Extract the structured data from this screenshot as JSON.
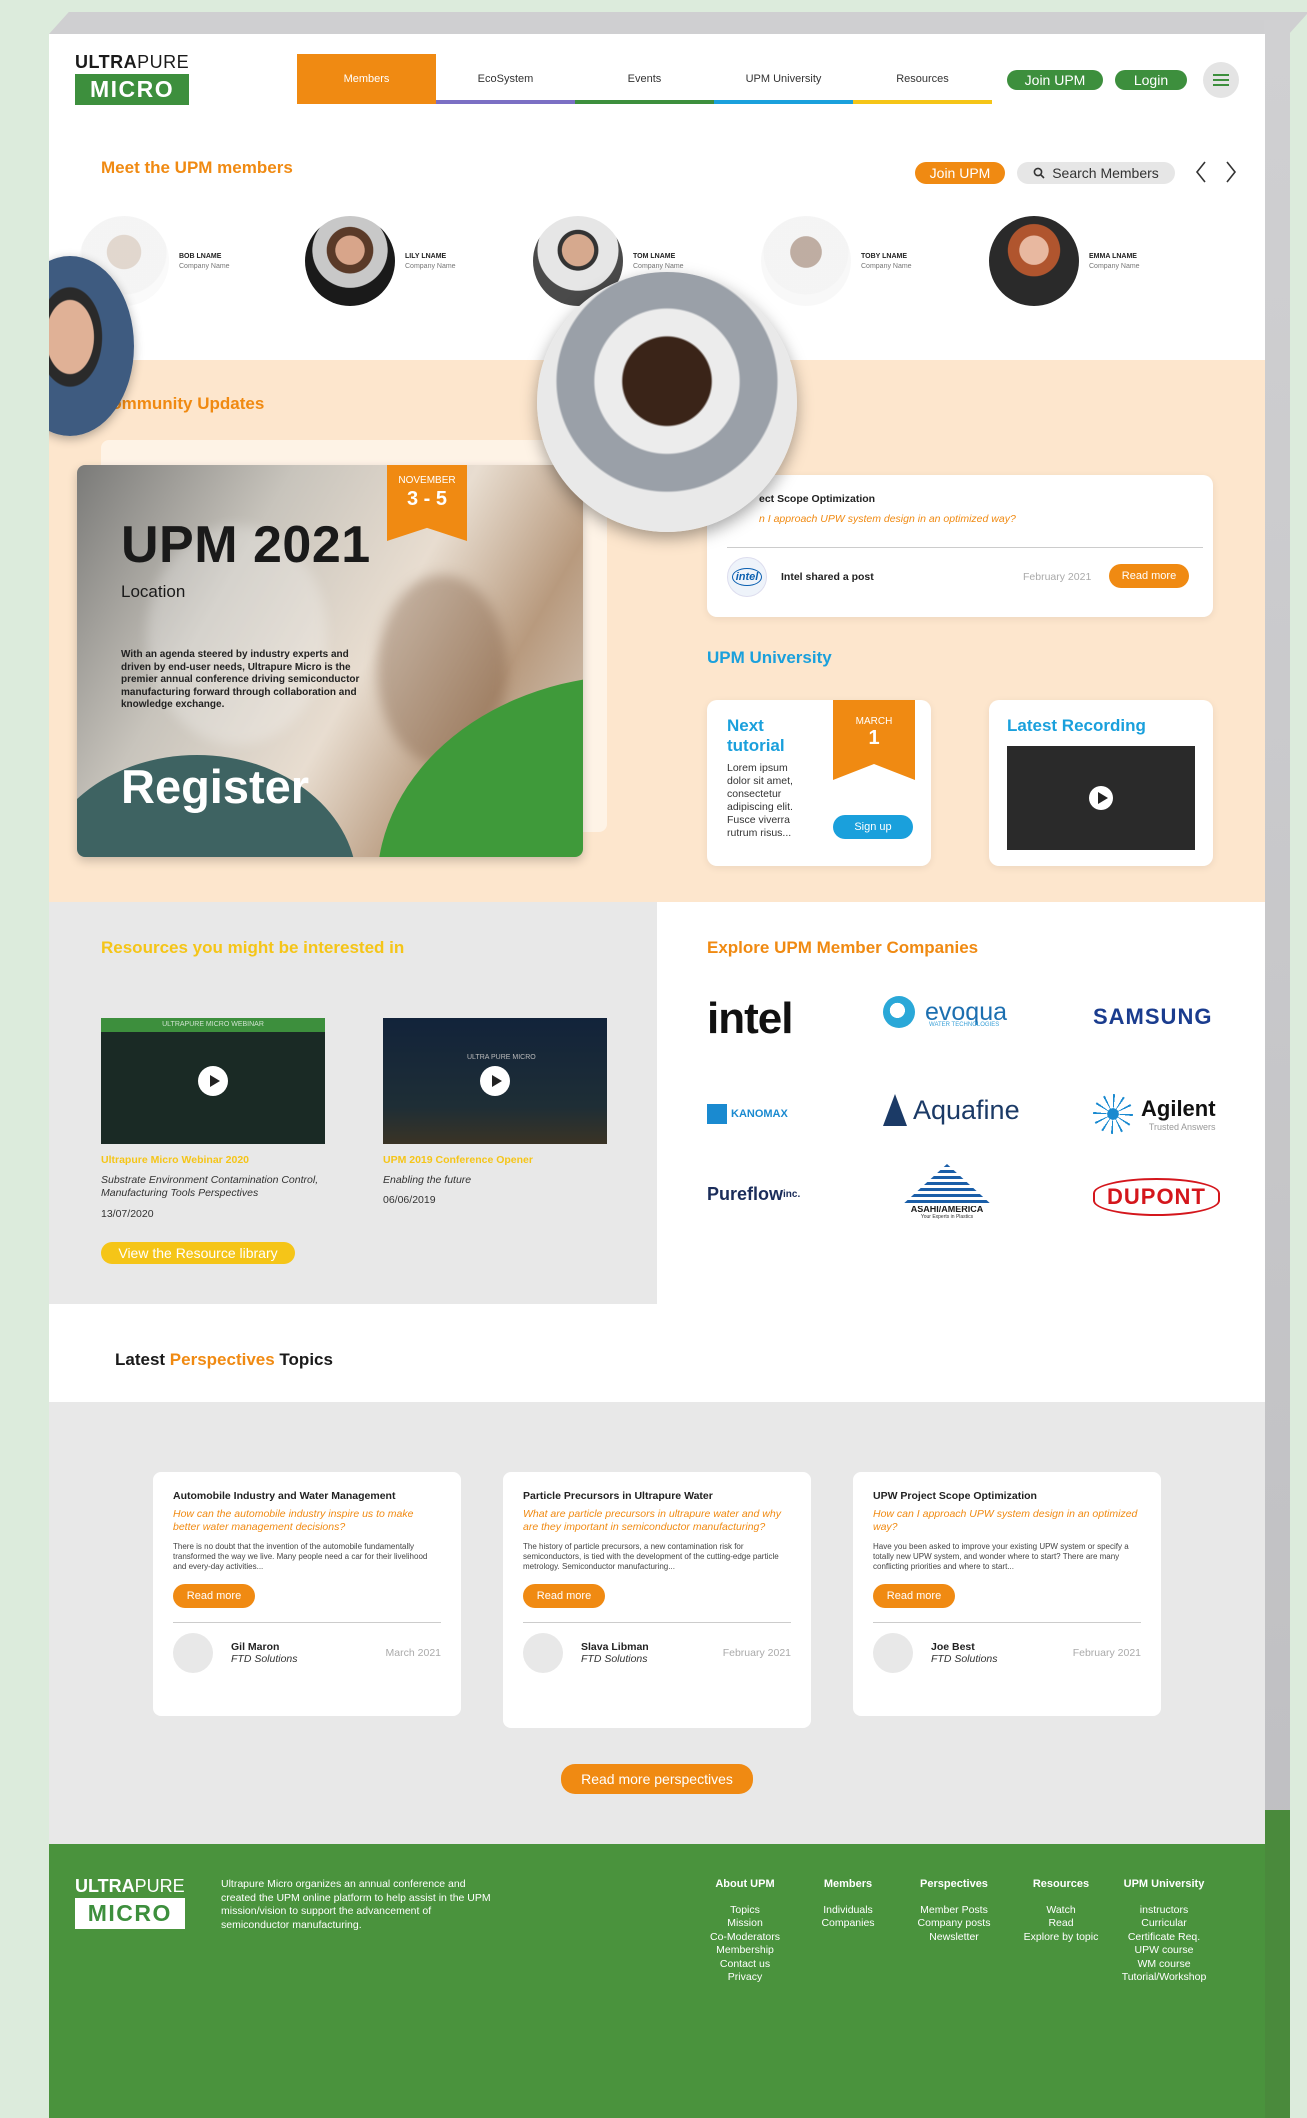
{
  "brand": {
    "top_bold": "ULTRA",
    "top_light": "PURE",
    "bottom": "MICRO"
  },
  "nav": {
    "items": [
      {
        "label": "Members",
        "color": "#f08a12"
      },
      {
        "label": "EcoSystem",
        "color": "#7b6fc4"
      },
      {
        "label": "Events",
        "color": "#3d8f3d"
      },
      {
        "label": "UPM University",
        "color": "#1aa0dc"
      },
      {
        "label": "Resources",
        "color": "#f5c518"
      }
    ],
    "join": "Join UPM",
    "login": "Login"
  },
  "members": {
    "title": "Meet the UPM members",
    "join": "Join UPM",
    "search": "Search Members",
    "list": [
      {
        "name": "BOB LNAME",
        "company": "Company Name"
      },
      {
        "name": "LILY LNAME",
        "company": "Company Name"
      },
      {
        "name": "TOM LNAME",
        "company": "Company Name"
      },
      {
        "name": "TOBY LNAME",
        "company": "Company Name"
      },
      {
        "name": "EMMA LNAME",
        "company": "Company Name"
      }
    ]
  },
  "community": {
    "title": "Community Updates",
    "event": {
      "month": "NOVEMBER",
      "days": "3 - 5",
      "title": "UPM 2021",
      "location": "Location",
      "desc": "With an agenda steered by industry experts and driven by end-user needs, Ultrapure Micro is the premier annual conference driving semiconductor manufacturing forward through collaboration and knowledge exchange.",
      "cta": "Register"
    },
    "post": {
      "title": "ect Scope Optimization",
      "question": "n I approach UPW system design in an optimized way?",
      "author_logo": "intel",
      "author": "Intel shared a post",
      "date": "February 2021",
      "read": "Read more"
    }
  },
  "university": {
    "title": "UPM University",
    "next": {
      "title": "Next tutorial",
      "text": "Lorem ipsum dolor sit amet, consectetur adipiscing elit. Fusce viverra rutrum risus...",
      "month": "MARCH",
      "day": "1",
      "cta": "Sign up"
    },
    "latest": {
      "title": "Latest Recording"
    }
  },
  "resources": {
    "title": "Resources you might be interested in",
    "items": [
      {
        "thumb_text": "ULTRAPURE MICRO WEBINAR",
        "title": "Ultrapure Micro Webinar 2020",
        "desc": "Substrate Environment Contamination Control, Manufacturing Tools Perspectives",
        "date": "13/07/2020"
      },
      {
        "thumb_text": "ULTRA PURE MICRO",
        "title": "UPM 2019 Conference Opener",
        "desc": "Enabling the future",
        "date": "06/06/2019"
      }
    ],
    "cta": "View the Resource library"
  },
  "companies": {
    "title": "Explore UPM Member Companies",
    "logos": [
      "intel",
      "evoqua",
      "WATER TECHNOLOGIES",
      "SAMSUNG",
      "KANOMAX",
      "Aquafine",
      "Agilent",
      "Trusted Answers",
      "Pureflow",
      "inc.",
      "ASAHI/AMERICA",
      "Your Experts in Plastics",
      "DUPONT"
    ]
  },
  "perspectives": {
    "title_a": "Latest ",
    "title_b": "Perspectives",
    "title_c": " Topics",
    "cards": [
      {
        "title": "Automobile Industry and Water Management",
        "question": "How can the automobile industry inspire us to make better water management decisions?",
        "desc": "There is no doubt that the invention of the automobile fundamentally transformed the way we live. Many people need a car for their livelihood and every-day activities...",
        "read": "Read more",
        "author": "Gil Maron",
        "company": "FTD Solutions",
        "date": "March 2021"
      },
      {
        "title": "Particle Precursors in Ultrapure Water",
        "question": "What are particle precursors in ultrapure water and why are they important in semiconductor manufacturing?",
        "desc": "The history of particle precursors, a new contamination risk for semiconductors, is tied with the development of the cutting-edge particle metrology. Semiconductor manufacturing...",
        "read": "Read more",
        "author": "Slava Libman",
        "company": "FTD Solutions",
        "date": "February 2021"
      },
      {
        "title": "UPW Project Scope Optimization",
        "question": "How can I approach UPW system design in an optimized way?",
        "desc": "Have you been asked to improve your existing UPW system or specify a totally new UPW system, and wonder where to start? There are many conflicting priorities and where to start...",
        "read": "Read more",
        "author": "Joe Best",
        "company": "FTD Solutions",
        "date": "February 2021"
      }
    ],
    "more": "Read more perspectives"
  },
  "footer": {
    "about": "Ultrapure Micro organizes an annual conference and created the UPM online platform to help assist in the UPM mission/vision to support the advancement of semiconductor manufacturing.",
    "cols": [
      {
        "h": "About UPM",
        "items": [
          "Topics",
          "Mission",
          "Co-Moderators",
          "Membership",
          "Contact us",
          "Privacy"
        ]
      },
      {
        "h": "Members",
        "items": [
          "Individuals",
          "Companies"
        ]
      },
      {
        "h": "Perspectives",
        "items": [
          "Member Posts",
          "Company posts",
          "Newsletter"
        ]
      },
      {
        "h": "Resources",
        "items": [
          "Watch",
          "Read",
          "Explore by topic"
        ]
      },
      {
        "h": "UPM University",
        "items": [
          "instructors",
          "Curricular",
          "Certificate Req.",
          "UPW course",
          "WM course",
          "Tutorial/Workshop"
        ]
      }
    ]
  }
}
